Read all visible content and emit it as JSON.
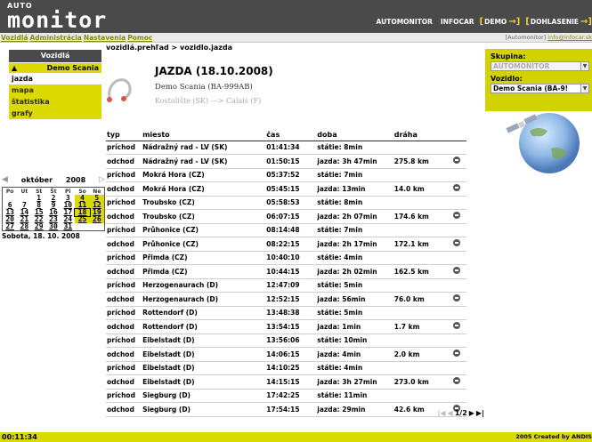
{
  "header": {
    "logo_small": "AUTO",
    "logo_big": "monitor",
    "nav": [
      "AUTOMONITOR",
      "INFOCAR"
    ],
    "demo": "DEMO",
    "login": "DOHLASENIE"
  },
  "menubar": {
    "items": [
      "Vozidlá",
      "Administrácia",
      "Nastavenia",
      "Pomoc"
    ],
    "user": "[Automonitor]",
    "email": "info@infocar.sk"
  },
  "sidebar": {
    "title": "Vozidlá",
    "vehicle": "Demo Scania",
    "items": [
      {
        "label": "jazda"
      },
      {
        "label": "mapa"
      },
      {
        "label": "štatistika"
      },
      {
        "label": "grafy"
      }
    ]
  },
  "calendar": {
    "month": "október",
    "year": "2008",
    "weekdays": [
      "Po",
      "Ut",
      "St",
      "Št",
      "Pi",
      "So",
      "Ne"
    ],
    "weeks": [
      [
        "",
        "",
        "1",
        "2",
        "3",
        "4",
        "5"
      ],
      [
        "6",
        "7",
        "8",
        "9",
        "10",
        "11",
        "12"
      ],
      [
        "13",
        "14",
        "15",
        "16",
        "17",
        "18",
        "19"
      ],
      [
        "20",
        "21",
        "22",
        "23",
        "24",
        "25",
        "26"
      ],
      [
        "27",
        "28",
        "29",
        "30",
        "31",
        "",
        ""
      ]
    ],
    "selected_day": "18",
    "date_label": "Sobota, 18. 10. 2008"
  },
  "main": {
    "breadcrumb": "vozidlá.prehľad > vozidlo.jazda",
    "trip_title": "JAZDA (18.10.2008)",
    "trip_vehicle": "Demo Scania (BA-999AB)",
    "trip_route": "Kostolište (SK) ---> Calais (F)",
    "columns": [
      "typ",
      "miesto",
      "čas",
      "doba",
      "dráha"
    ],
    "rows": [
      {
        "typ": "príchod",
        "miesto": "Nádražný rad - LV (SK)",
        "cas": "01:41:34",
        "doba": "státie: 8min",
        "draha": "",
        "map": false
      },
      {
        "typ": "odchod",
        "miesto": "Nádražný rad - LV (SK)",
        "cas": "01:50:15",
        "doba": "jazda: 3h 47min",
        "draha": "275.8 km",
        "map": true
      },
      {
        "typ": "príchod",
        "miesto": "Mokrá Hora (CZ)",
        "cas": "05:37:52",
        "doba": "státie: 7min",
        "draha": "",
        "map": false
      },
      {
        "typ": "odchod",
        "miesto": "Mokrá Hora (CZ)",
        "cas": "05:45:15",
        "doba": "jazda: 13min",
        "draha": "14.0 km",
        "map": true
      },
      {
        "typ": "príchod",
        "miesto": "Troubsko (CZ)",
        "cas": "05:58:53",
        "doba": "státie: 8min",
        "draha": "",
        "map": false
      },
      {
        "typ": "odchod",
        "miesto": "Troubsko (CZ)",
        "cas": "06:07:15",
        "doba": "jazda: 2h 07min",
        "draha": "174.6 km",
        "map": true
      },
      {
        "typ": "príchod",
        "miesto": "Průhonice (CZ)",
        "cas": "08:14:48",
        "doba": "státie: 7min",
        "draha": "",
        "map": false
      },
      {
        "typ": "odchod",
        "miesto": "Průhonice (CZ)",
        "cas": "08:22:15",
        "doba": "jazda: 2h 17min",
        "draha": "172.1 km",
        "map": true
      },
      {
        "typ": "príchod",
        "miesto": "Přimda (CZ)",
        "cas": "10:40:10",
        "doba": "státie: 4min",
        "draha": "",
        "map": false
      },
      {
        "typ": "odchod",
        "miesto": "Přimda (CZ)",
        "cas": "10:44:15",
        "doba": "jazda: 2h 02min",
        "draha": "162.5 km",
        "map": true
      },
      {
        "typ": "príchod",
        "miesto": "Herzogenaurach (D)",
        "cas": "12:47:09",
        "doba": "státie: 5min",
        "draha": "",
        "map": false
      },
      {
        "typ": "odchod",
        "miesto": "Herzogenaurach (D)",
        "cas": "12:52:15",
        "doba": "jazda: 56min",
        "draha": "76.0 km",
        "map": true
      },
      {
        "typ": "príchod",
        "miesto": "Rottendorf (D)",
        "cas": "13:48:38",
        "doba": "státie: 5min",
        "draha": "",
        "map": false
      },
      {
        "typ": "odchod",
        "miesto": "Rottendorf (D)",
        "cas": "13:54:15",
        "doba": "jazda: 1min",
        "draha": "1.7 km",
        "map": true
      },
      {
        "typ": "príchod",
        "miesto": "Eibelstadt (D)",
        "cas": "13:56:06",
        "doba": "státie: 10min",
        "draha": "",
        "map": false
      },
      {
        "typ": "odchod",
        "miesto": "Eibelstadt (D)",
        "cas": "14:06:15",
        "doba": "jazda: 4min",
        "draha": "2.0 km",
        "map": true
      },
      {
        "typ": "príchod",
        "miesto": "Eibelstadt (D)",
        "cas": "14:10:25",
        "doba": "státie: 4min",
        "draha": "",
        "map": false
      },
      {
        "typ": "odchod",
        "miesto": "Eibelstadt (D)",
        "cas": "14:15:15",
        "doba": "jazda: 3h 27min",
        "draha": "273.0 km",
        "map": true
      },
      {
        "typ": "príchod",
        "miesto": "Siegburg (D)",
        "cas": "17:42:25",
        "doba": "státie: 11min",
        "draha": "",
        "map": false
      },
      {
        "typ": "odchod",
        "miesto": "Siegburg (D)",
        "cas": "17:54:15",
        "doba": "jazda: 29min",
        "draha": "42.6 km",
        "map": true
      }
    ],
    "pager": "1/2"
  },
  "filter": {
    "group_label": "Skupina:",
    "group_value": "AUTOMONITOR",
    "vehicle_label": "Vozidlo:",
    "vehicle_value": "Demo Scania (BA-9!"
  },
  "footer": {
    "clock": "00:11:34",
    "credit": "2005 Created by ANDIS"
  },
  "colors": {
    "header_bg": "#4a4a4a",
    "accent_yellow": "#dada00",
    "bracket_yellow": "#f5d11a"
  }
}
